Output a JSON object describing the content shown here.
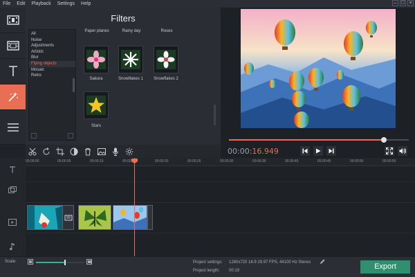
{
  "menu": {
    "items": [
      "File",
      "Edit",
      "Playback",
      "Settings",
      "Help"
    ]
  },
  "window_controls": [
    "–",
    "□",
    "×"
  ],
  "sidebar_tools": [
    {
      "icon": "film-import-icon"
    },
    {
      "icon": "filmstrip-icon"
    },
    {
      "icon": "text-T-icon"
    },
    {
      "icon": "magic-wand-icon",
      "active": true
    },
    {
      "icon": "hamburger-menu-icon"
    }
  ],
  "filters": {
    "title": "Filters",
    "categories": [
      "All",
      "Noise",
      "Adjustments",
      "Artistic",
      "Blur",
      "Flying objects",
      "Mosaic",
      "Retro"
    ],
    "selected_category": "Flying objects",
    "top_labels": [
      "Paper planes",
      "Rainy day",
      "Roses"
    ],
    "items": [
      {
        "label": "Sakura"
      },
      {
        "label": "Snowflakes 1"
      },
      {
        "label": "Snowflakes 2"
      },
      {
        "label": "Stars"
      }
    ]
  },
  "player": {
    "time_dim": "00:00:",
    "time_active": "16.949",
    "position_fraction": 0.86
  },
  "timeline": {
    "ticks": [
      "00:00:00",
      "00:00:05",
      "00:00:10",
      "00:00:15",
      "00:00:20",
      "00:00:25",
      "00:00:30",
      "00:00:35",
      "00:00:40",
      "00:00:45",
      "00:00:50",
      "00:00:55"
    ]
  },
  "bottom": {
    "scale_label": "Scale:",
    "scale_fraction": 0.6,
    "settings_label": "Project settings:",
    "settings_value": "1280x720 16:9 29.97 FPS, 44100 Hz Stereo",
    "length_label": "Project length:",
    "length_value": "00:19",
    "export_label": "Export"
  },
  "colors": {
    "accent": "#e86f53",
    "export": "#2f8f6e",
    "panel": "#2a2e34"
  }
}
